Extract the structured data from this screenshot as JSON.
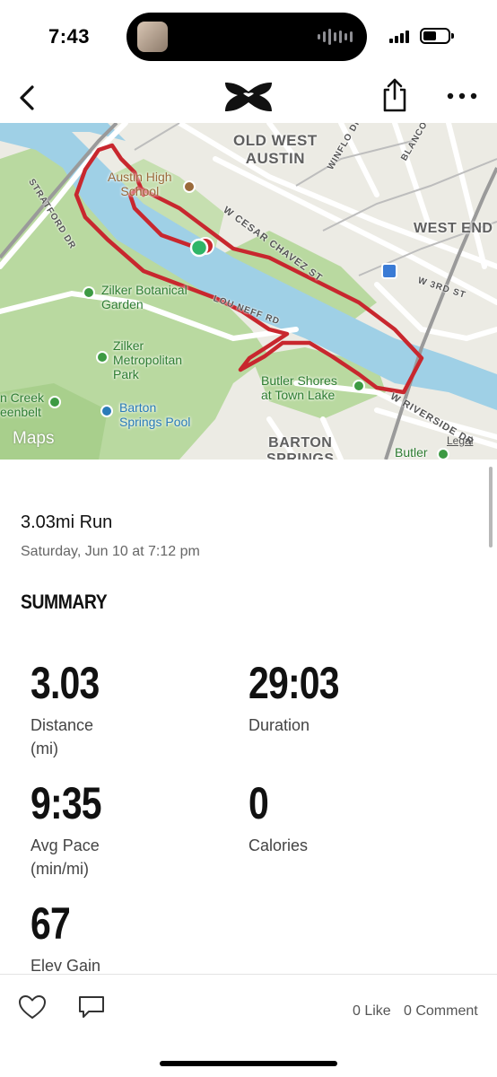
{
  "status_bar": {
    "time": "7:43",
    "icons": [
      "signal-icon",
      "battery-icon"
    ]
  },
  "nav": {
    "back_icon": "chevron-left-icon",
    "logo": "under-armour-logo",
    "share_icon": "share-icon",
    "more_icon": "more-horizontal-icon"
  },
  "map": {
    "labels": {
      "old_west_austin": "OLD WEST\nAUSTIN",
      "west_end": "WEST END",
      "barton_springs": "BARTON\nSPRINGS",
      "austin_high": "Austin High\nSchool",
      "zilker_garden": "Zilker Botanical\nGarden",
      "zilker_park": "Zilker\nMetropolitan\nPark",
      "creek_greenbelt": "n Creek\neenbelt",
      "barton_pool": "Barton\nSprings Pool",
      "butler_shores": "Butler Shores\nat Town Lake",
      "butler": "Butler",
      "stratford": "STRATFORD DR",
      "cesar_chavez": "W CESAR CHAVEZ ST",
      "lou_neff": "LOU NEFF RD",
      "riverside": "W RIVERSIDE DR",
      "third_st": "W 3RD ST",
      "winflo": "WINFLO DR",
      "blanco": "BLANCO"
    },
    "brand": "Maps",
    "legal": "Legal",
    "colors": {
      "water": "#9fd0e6",
      "park": "#b9d9a0",
      "route": "#c8272e",
      "start_marker": "#2fb567"
    }
  },
  "activity": {
    "title": "3.03mi Run",
    "date": "Saturday, Jun 10 at 7:12 pm"
  },
  "summary": {
    "heading": "SUMMARY",
    "stats": [
      {
        "value": "3.03",
        "label": "Distance\n(mi)"
      },
      {
        "value": "29:03",
        "label": "Duration"
      },
      {
        "value": "9:35",
        "label": "Avg Pace\n(min/mi)"
      },
      {
        "value": "0",
        "label": "Calories"
      },
      {
        "value": "67",
        "label": "Elev Gain"
      }
    ]
  },
  "social": {
    "like_icon": "heart-icon",
    "comment_icon": "comment-icon",
    "like_label": "0 Like",
    "comment_label": "0 Comment"
  }
}
